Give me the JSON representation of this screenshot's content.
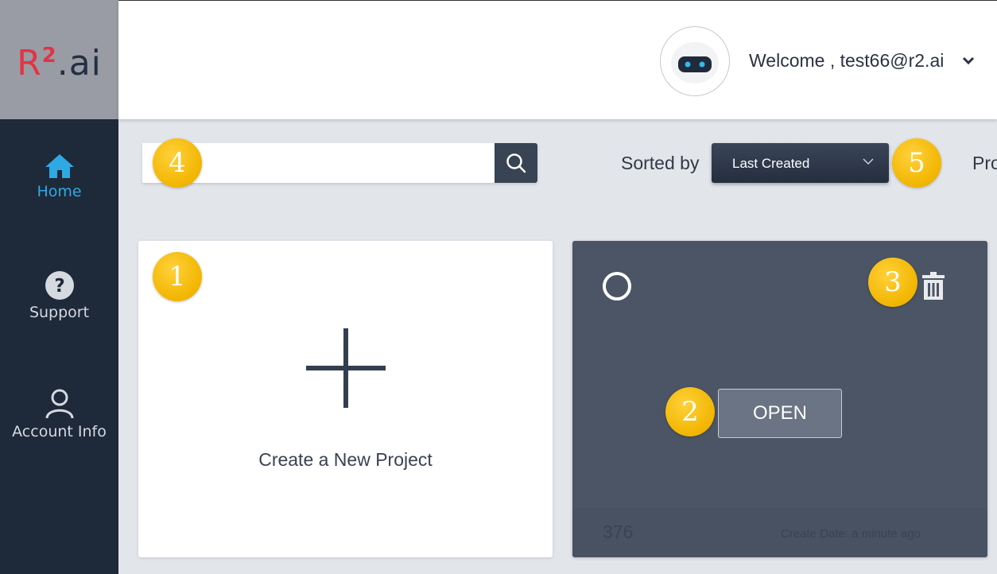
{
  "brand": {
    "r": "R",
    "sup": "2",
    "ai": ".ai"
  },
  "header": {
    "welcome": "Welcome , test66@r2.ai"
  },
  "sidebar": {
    "items": [
      {
        "label": "Home",
        "icon": "home-icon"
      },
      {
        "label": "Support",
        "icon": "question-icon"
      },
      {
        "label": "Account Info",
        "icon": "user-icon"
      }
    ]
  },
  "search": {
    "placeholder": ""
  },
  "sort": {
    "label": "Sorted by",
    "value": "Last Created",
    "cut_off_text": "Pro"
  },
  "new_project": {
    "label": "Create a New Project"
  },
  "project": {
    "open_label": "OPEN",
    "number": "376",
    "create_date": "Create Date: a minute ago"
  },
  "callouts": [
    "1",
    "2",
    "3",
    "4",
    "5"
  ],
  "colors": {
    "sidebar": "#1e2939",
    "accent": "#2fa9e4",
    "card_dark": "#4b5565",
    "badge": "#f2b500",
    "logo_red": "#e23444"
  }
}
